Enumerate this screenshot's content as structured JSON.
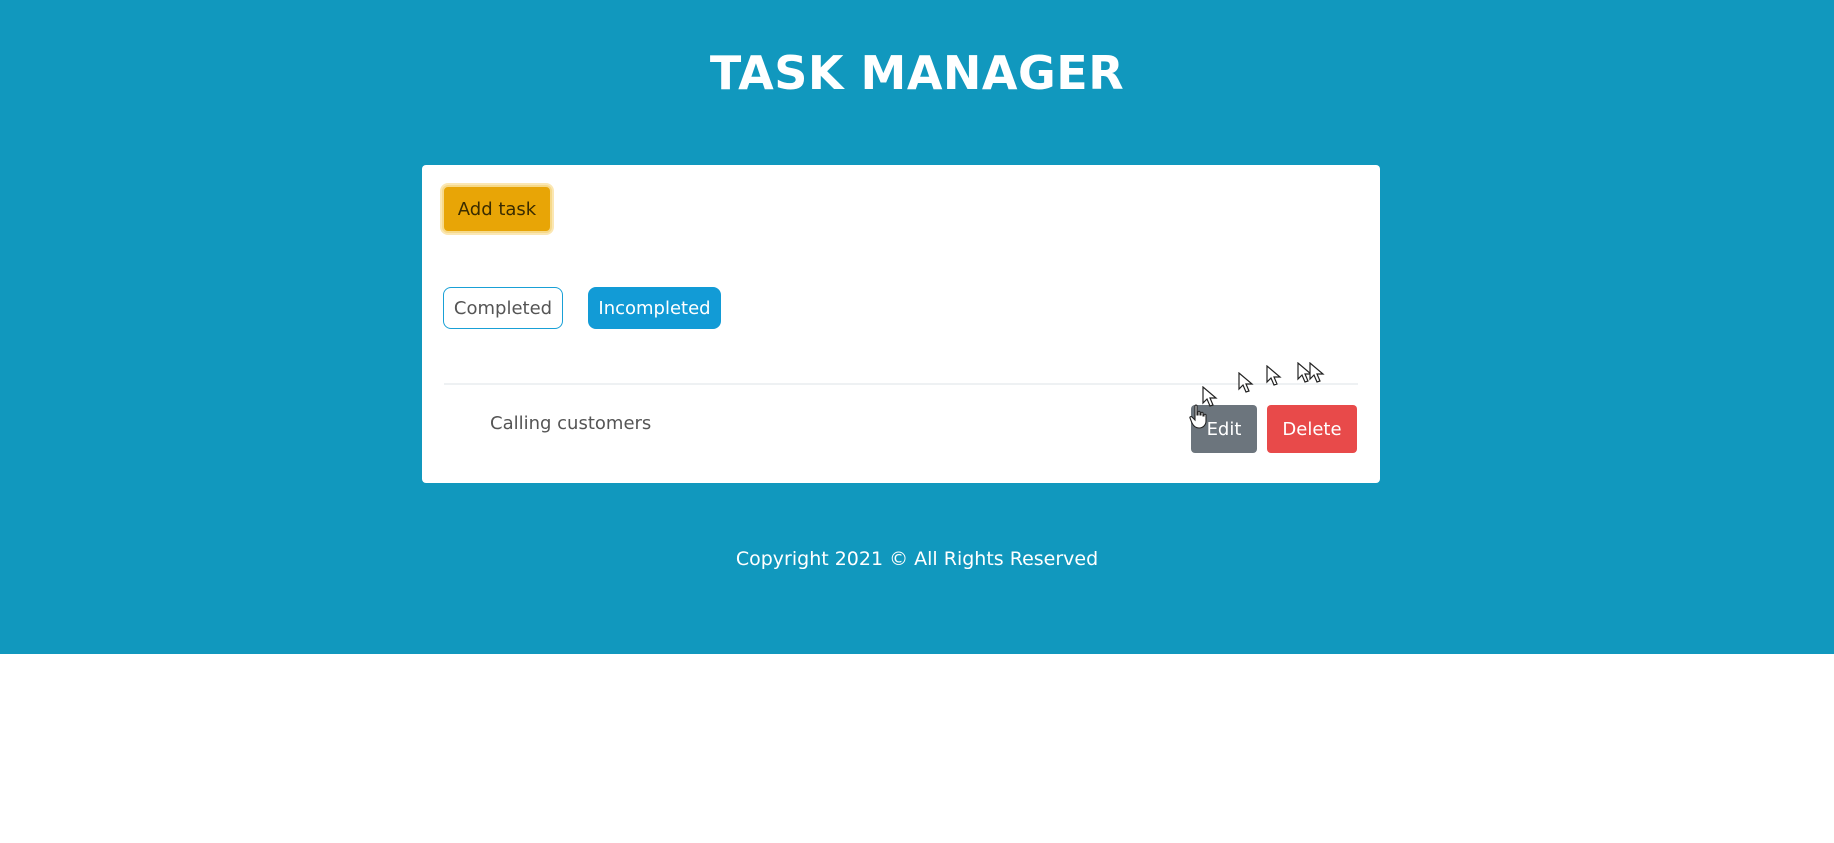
{
  "header": {
    "title": "TASK MANAGER"
  },
  "toolbar": {
    "add_task_label": "Add task"
  },
  "filters": {
    "completed_label": "Completed",
    "incompleted_label": "Incompleted",
    "active": "Incompleted"
  },
  "tasks": [
    {
      "title": "Calling customers",
      "edit_label": "Edit",
      "delete_label": "Delete"
    }
  ],
  "footer": {
    "copyright": "Copyright 2021 © All Rights Reserved"
  },
  "colors": {
    "background": "#1198be",
    "add_task": "#e8a506",
    "filter_active": "#129bd6",
    "edit": "#6c757d",
    "delete": "#e84a4a"
  },
  "icons": [
    "mouse-pointer-icon",
    "hand-pointer-icon"
  ]
}
